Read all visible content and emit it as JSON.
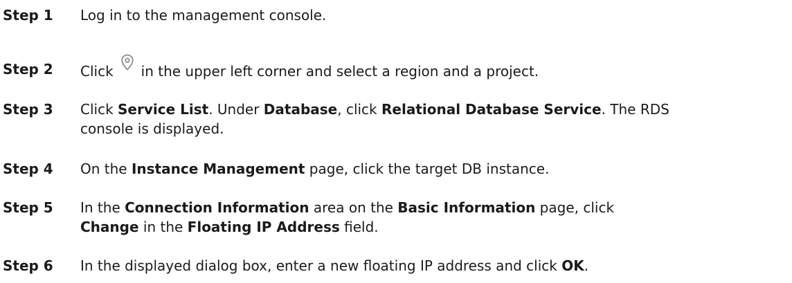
{
  "steps": [
    {
      "label": "Step 1",
      "text": "Log in to the management console."
    },
    {
      "label": "Step 2",
      "before_icon": "Click",
      "icon": "location-pin-icon",
      "after_icon": "in the upper left corner and select a region and a project."
    },
    {
      "label": "Step 3",
      "parts": [
        "Click ",
        "Service List",
        ". Under ",
        "Database",
        ", click ",
        "Relational Database Service",
        ". The RDS"
      ],
      "line2": "console is displayed."
    },
    {
      "label": "Step 4",
      "parts": [
        "On the ",
        "Instance Management",
        " page, click the target DB instance."
      ]
    },
    {
      "label": "Step 5",
      "parts": [
        "In the ",
        "Connection Information",
        " area on the ",
        "Basic Information",
        " page, click"
      ],
      "line2_parts": [
        "Change",
        " in the ",
        "Floating IP Address",
        " field."
      ]
    },
    {
      "label": "Step 6",
      "parts": [
        "In the displayed dialog box, enter a new floating IP address and click ",
        "OK",
        "."
      ]
    }
  ],
  "colors": {
    "text": "#1a1a1a",
    "icon": "#8c8c8c"
  }
}
